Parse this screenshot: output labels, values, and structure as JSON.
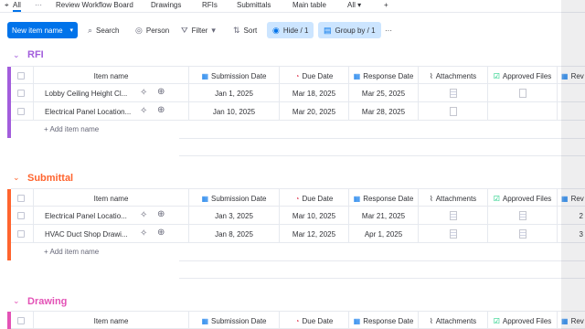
{
  "tabs": {
    "all": "All",
    "review": "Review Workflow Board",
    "drawings": "Drawings",
    "rfis": "RFIs",
    "submittals": "Submittals",
    "main_table": "Main table",
    "all_dropdown": "All",
    "add": "+"
  },
  "toolbar": {
    "new_item": "New item name",
    "search": "Search",
    "person": "Person",
    "filter": "Filter",
    "sort": "Sort",
    "hide": "Hide / 1",
    "group_by": "Group by / 1",
    "more": "···"
  },
  "columns": {
    "item_name": "Item name",
    "submission_date": "Submission Date",
    "due_date": "Due Date",
    "response_date": "Response Date",
    "attachments": "Attachments",
    "approved_files": "Approved Files",
    "rev": "Rev"
  },
  "add_item": "+ Add item name",
  "colors": {
    "accent": "#0073ea",
    "rfi": "#a25ddc",
    "submittal": "#ff642e",
    "drawing": "#e352b6"
  },
  "groups": {
    "rfi": {
      "title": "RFI",
      "rows": [
        {
          "name": "Lobby Ceiling Height Cl...",
          "submission": "Jan 1, 2025",
          "due": "Mar 18, 2025",
          "response": "Mar 25, 2025"
        },
        {
          "name": "Electrical Panel Location...",
          "submission": "Jan 10, 2025",
          "due": "Mar 20, 2025",
          "response": "Mar 28, 2025"
        }
      ]
    },
    "submittal": {
      "title": "Submittal",
      "rows": [
        {
          "name": "Electrical Panel Locatio...",
          "submission": "Jan 3, 2025",
          "due": "Mar 10, 2025",
          "response": "Mar 21, 2025",
          "rev": "2"
        },
        {
          "name": "HVAC Duct Shop Drawi...",
          "submission": "Jan 8, 2025",
          "due": "Mar 12, 2025",
          "response": "Apr 1, 2025",
          "rev": "3"
        }
      ]
    },
    "drawing": {
      "title": "Drawing"
    }
  }
}
